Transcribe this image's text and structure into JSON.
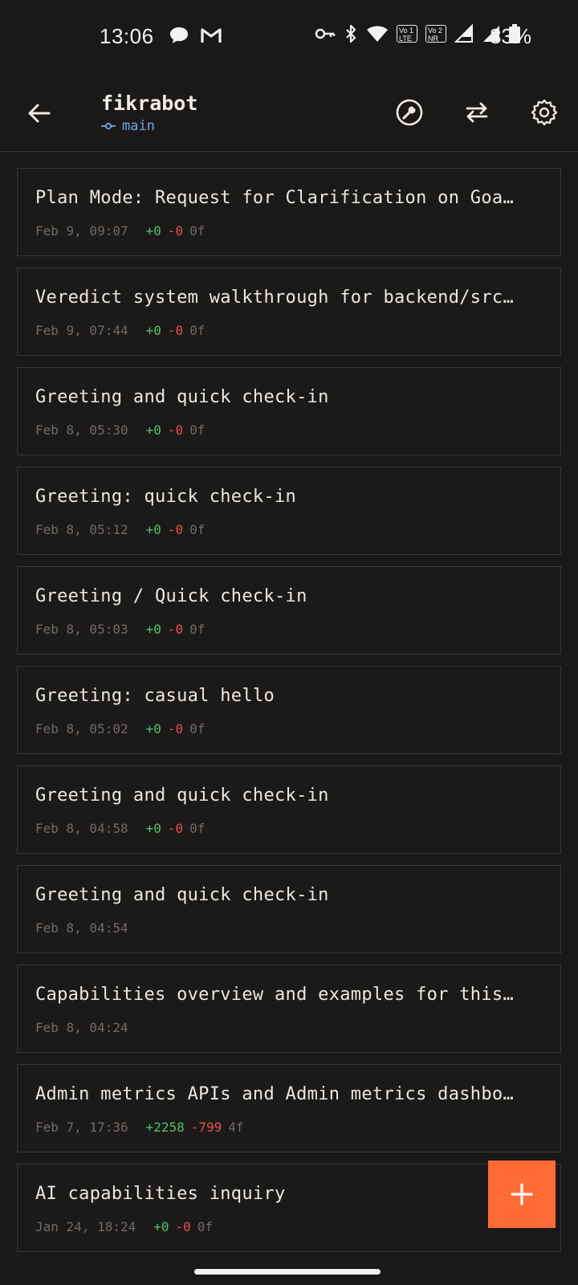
{
  "status_bar": {
    "time": "13:06",
    "battery_percent": "83%",
    "left_icons": [
      "chat-bubble-icon",
      "gmail-icon"
    ],
    "right_icons": [
      "vpn-key-icon",
      "bluetooth-icon",
      "wifi-icon",
      "volte-lte-icon",
      "vonr-icon",
      "signal-r-icon",
      "signal-icon",
      "battery-icon"
    ],
    "volte_badge": {
      "top": "Vo",
      "sub": "1",
      "bottom": "LTE"
    },
    "vonr_badge": {
      "top": "Vo",
      "sub": "2",
      "bottom": "NR"
    }
  },
  "header": {
    "title": "fikrabot",
    "branch": "main",
    "actions": [
      "wrench-icon",
      "swap-icon",
      "gear-icon"
    ]
  },
  "sessions": [
    {
      "title": "Plan Mode: Request for Clarification on Goa…",
      "date": "Feb 9, 09:07",
      "added": "+0",
      "removed": "-0",
      "files": "0f"
    },
    {
      "title": "Veredict system walkthrough for backend/src…",
      "date": "Feb 9, 07:44",
      "added": "+0",
      "removed": "-0",
      "files": "0f"
    },
    {
      "title": "Greeting and quick check-in",
      "date": "Feb 8, 05:30",
      "added": "+0",
      "removed": "-0",
      "files": "0f"
    },
    {
      "title": "Greeting: quick check-in",
      "date": "Feb 8, 05:12",
      "added": "+0",
      "removed": "-0",
      "files": "0f"
    },
    {
      "title": "Greeting / Quick check-in",
      "date": "Feb 8, 05:03",
      "added": "+0",
      "removed": "-0",
      "files": "0f"
    },
    {
      "title": "Greeting: casual hello",
      "date": "Feb 8, 05:02",
      "added": "+0",
      "removed": "-0",
      "files": "0f"
    },
    {
      "title": "Greeting and quick check-in",
      "date": "Feb 8, 04:58",
      "added": "+0",
      "removed": "-0",
      "files": "0f"
    },
    {
      "title": "Greeting and quick check-in",
      "date": "Feb 8, 04:54",
      "added": "",
      "removed": "",
      "files": ""
    },
    {
      "title": "Capabilities overview and examples for this…",
      "date": "Feb 8, 04:24",
      "added": "",
      "removed": "",
      "files": ""
    },
    {
      "title": "Admin metrics APIs and Admin metrics dashbo…",
      "date": "Feb 7, 17:36",
      "added": "+2258",
      "removed": "-799",
      "files": "4f"
    },
    {
      "title": "AI capabilities inquiry",
      "date": "Jan 24, 18:24",
      "added": "+0",
      "removed": "-0",
      "files": "0f"
    }
  ],
  "fab": {
    "icon": "plus-icon"
  },
  "colors": {
    "background": "#1b1918",
    "accent": "#ff6b35",
    "added": "#4fc16a",
    "removed": "#e05050",
    "branch": "#6ea7e6"
  }
}
